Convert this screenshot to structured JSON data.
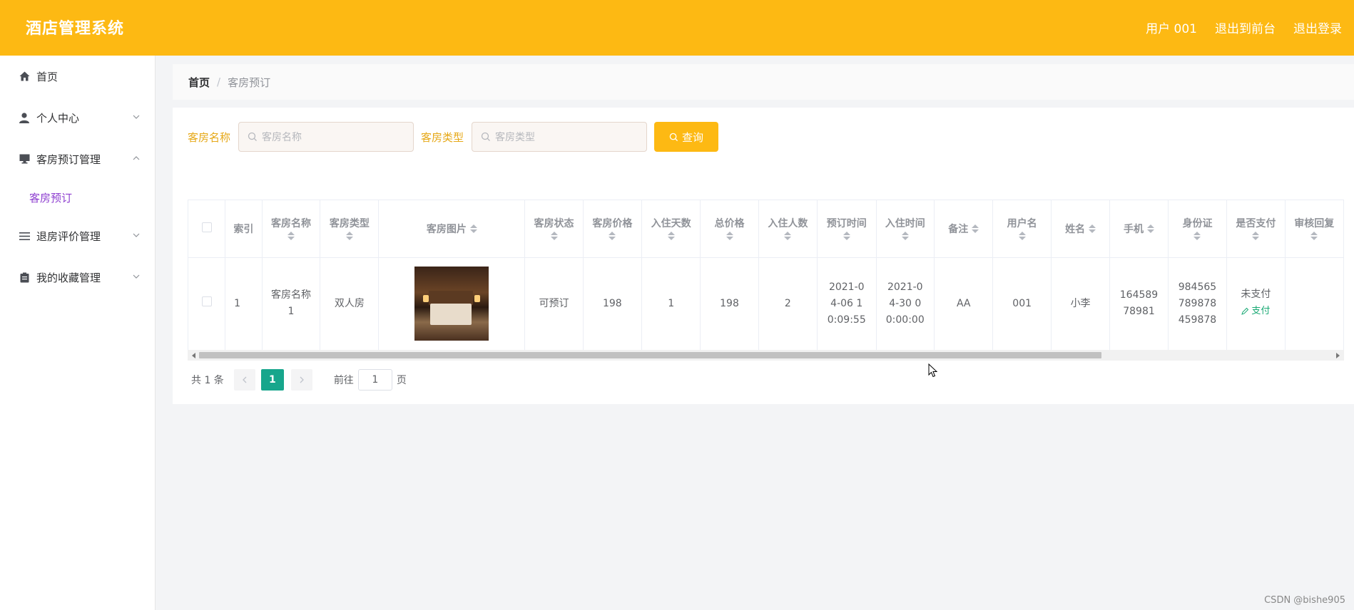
{
  "header": {
    "app_title": "酒店管理系统",
    "user_label": "用户 001",
    "back_front": "退出到前台",
    "logout": "退出登录"
  },
  "sidebar": {
    "items": [
      {
        "label": "首页",
        "icon": "home-icon"
      },
      {
        "label": "个人中心",
        "icon": "user-icon"
      },
      {
        "label": "客房预订管理",
        "icon": "monitor-icon",
        "children": [
          "客房预订"
        ]
      },
      {
        "label": "退房评价管理",
        "icon": "list-icon"
      },
      {
        "label": "我的收藏管理",
        "icon": "clipboard-icon"
      }
    ]
  },
  "breadcrumb": {
    "home": "首页",
    "separator": "/",
    "current": "客房预订"
  },
  "search": {
    "name_label": "客房名称",
    "name_placeholder": "客房名称",
    "type_label": "客房类型",
    "type_placeholder": "客房类型",
    "query_button": "查询"
  },
  "table": {
    "columns": [
      "索引",
      "客房名称",
      "客房类型",
      "客房图片",
      "客房状态",
      "客房价格",
      "入住天数",
      "总价格",
      "入住人数",
      "预订时间",
      "入住时间",
      "备注",
      "用户名",
      "姓名",
      "手机",
      "身份证",
      "是否支付",
      "审核回复"
    ],
    "rows": [
      {
        "index": "1",
        "room_name": "客房名称1",
        "room_type": "双人房",
        "status": "可预订",
        "price": "198",
        "days": "1",
        "total": "198",
        "people": "2",
        "booking_time": "2021-04-06 10:09:55",
        "checkin_time": "2021-04-30 00:00:00",
        "note": "AA",
        "username": "001",
        "name": "小李",
        "phone": "16458978981",
        "id_card": "984565789878459878",
        "paid": "未支付",
        "pay_link": "支付",
        "review_reply": ""
      }
    ]
  },
  "pagination": {
    "total": "共 1 条",
    "current_page": "1",
    "goto_label": "前往",
    "goto_value": "1",
    "page_unit": "页"
  },
  "watermark": "CSDN @bishe905",
  "colors": {
    "primary": "#fdb913",
    "pager_active": "#17a68c",
    "submenu_active": "#8e3fd0",
    "pay_link": "#19a974"
  }
}
